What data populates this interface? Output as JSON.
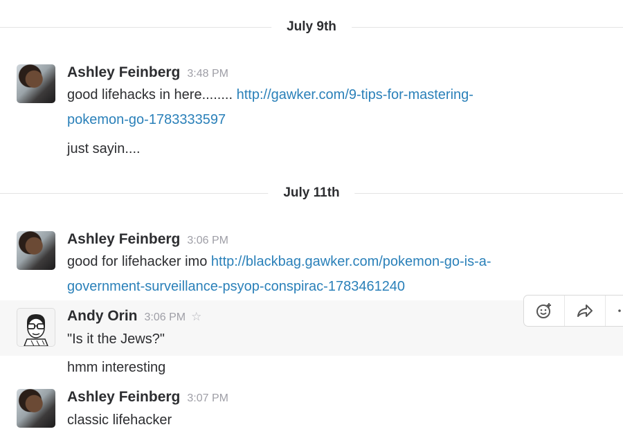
{
  "dividers": [
    "July 9th",
    "July 11th"
  ],
  "messages": [
    {
      "author": "Ashley Feinberg",
      "time": "3:48 PM",
      "text_line1": "good lifehacks in here........",
      "link_line1": "http://gawker.com/9-tips-for-mastering-",
      "link_line2": "pokemon-go-1783333597",
      "followup": "just sayin...."
    },
    {
      "author": "Ashley Feinberg",
      "time": "3:06 PM",
      "text_line1": "good for lifehacker imo",
      "link_line1": "http://blackbag.gawker.com/pokemon-go-is-a-",
      "link_line2": "government-surveillance-psyop-conspirac-1783461240"
    },
    {
      "author": "Andy Orin",
      "time": "3:06 PM",
      "text": "\"Is it the Jews?\"",
      "followup": "hmm interesting"
    },
    {
      "author": "Ashley Feinberg",
      "time": "3:07 PM",
      "text": "classic lifehacker"
    }
  ],
  "icons": {
    "star": "star-icon",
    "reaction": "add-reaction-icon",
    "share": "share-icon",
    "more": "more-actions-icon"
  }
}
